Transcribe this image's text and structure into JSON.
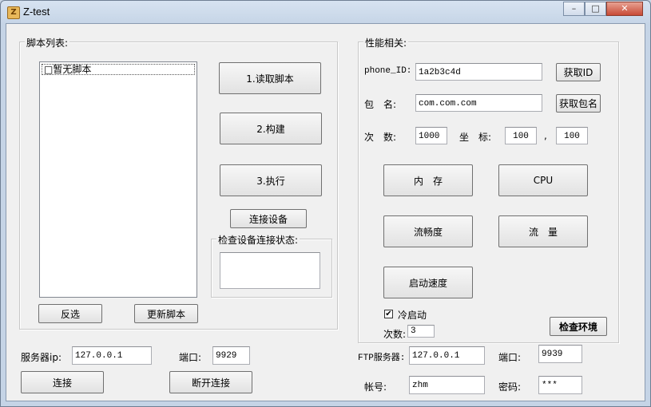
{
  "window": {
    "title": "Z-test",
    "minimize": "–",
    "maximize": "□",
    "close": "✕"
  },
  "scripts_group": {
    "title": "脚本列表:",
    "list_items": [
      "□暂无脚本"
    ],
    "read_button": "1.读取脚本",
    "build_button": "2.构建",
    "execute_button": "3.执行",
    "connect_device_button": "连接设备",
    "status_group_title": "检查设备连接状态:",
    "status_value": "",
    "invert_button": "反选",
    "update_button": "更新脚本"
  },
  "perf_group": {
    "title": "性能相关:",
    "phone_id_label": "phone_ID:",
    "phone_id_value": "1a2b3c4d",
    "get_id_button": "获取ID",
    "package_label": "包　名:",
    "package_value": "com.com.com",
    "get_package_button": "获取包名",
    "count_label": "次　数:",
    "count_value": "1000",
    "coord_label": "坐　标:",
    "coord_x": "100",
    "coord_sep": ",",
    "coord_y": "100",
    "memory_button": "内　存",
    "cpu_button": "CPU",
    "smooth_button": "流畅度",
    "traffic_button": "流　量",
    "startup_button": "启动速度",
    "cold_start_label": "冷启动",
    "cold_start_checked": true,
    "times_label": "次数:",
    "times_value": "3",
    "check_env_button": "检查环境"
  },
  "server": {
    "ip_label": "服务器ip:",
    "ip_value": "127.0.0.1",
    "port_label": "端口:",
    "port_value": "9929",
    "connect_button": "连接",
    "disconnect_button": "断开连接"
  },
  "ftp": {
    "ip_label": "FTP服务器:",
    "ip_value": "127.0.0.1",
    "port_label": "端口:",
    "port_value": "9939",
    "account_label": "帐号:",
    "account_value": "zhm",
    "password_label": "密码:",
    "password_value": "***"
  }
}
